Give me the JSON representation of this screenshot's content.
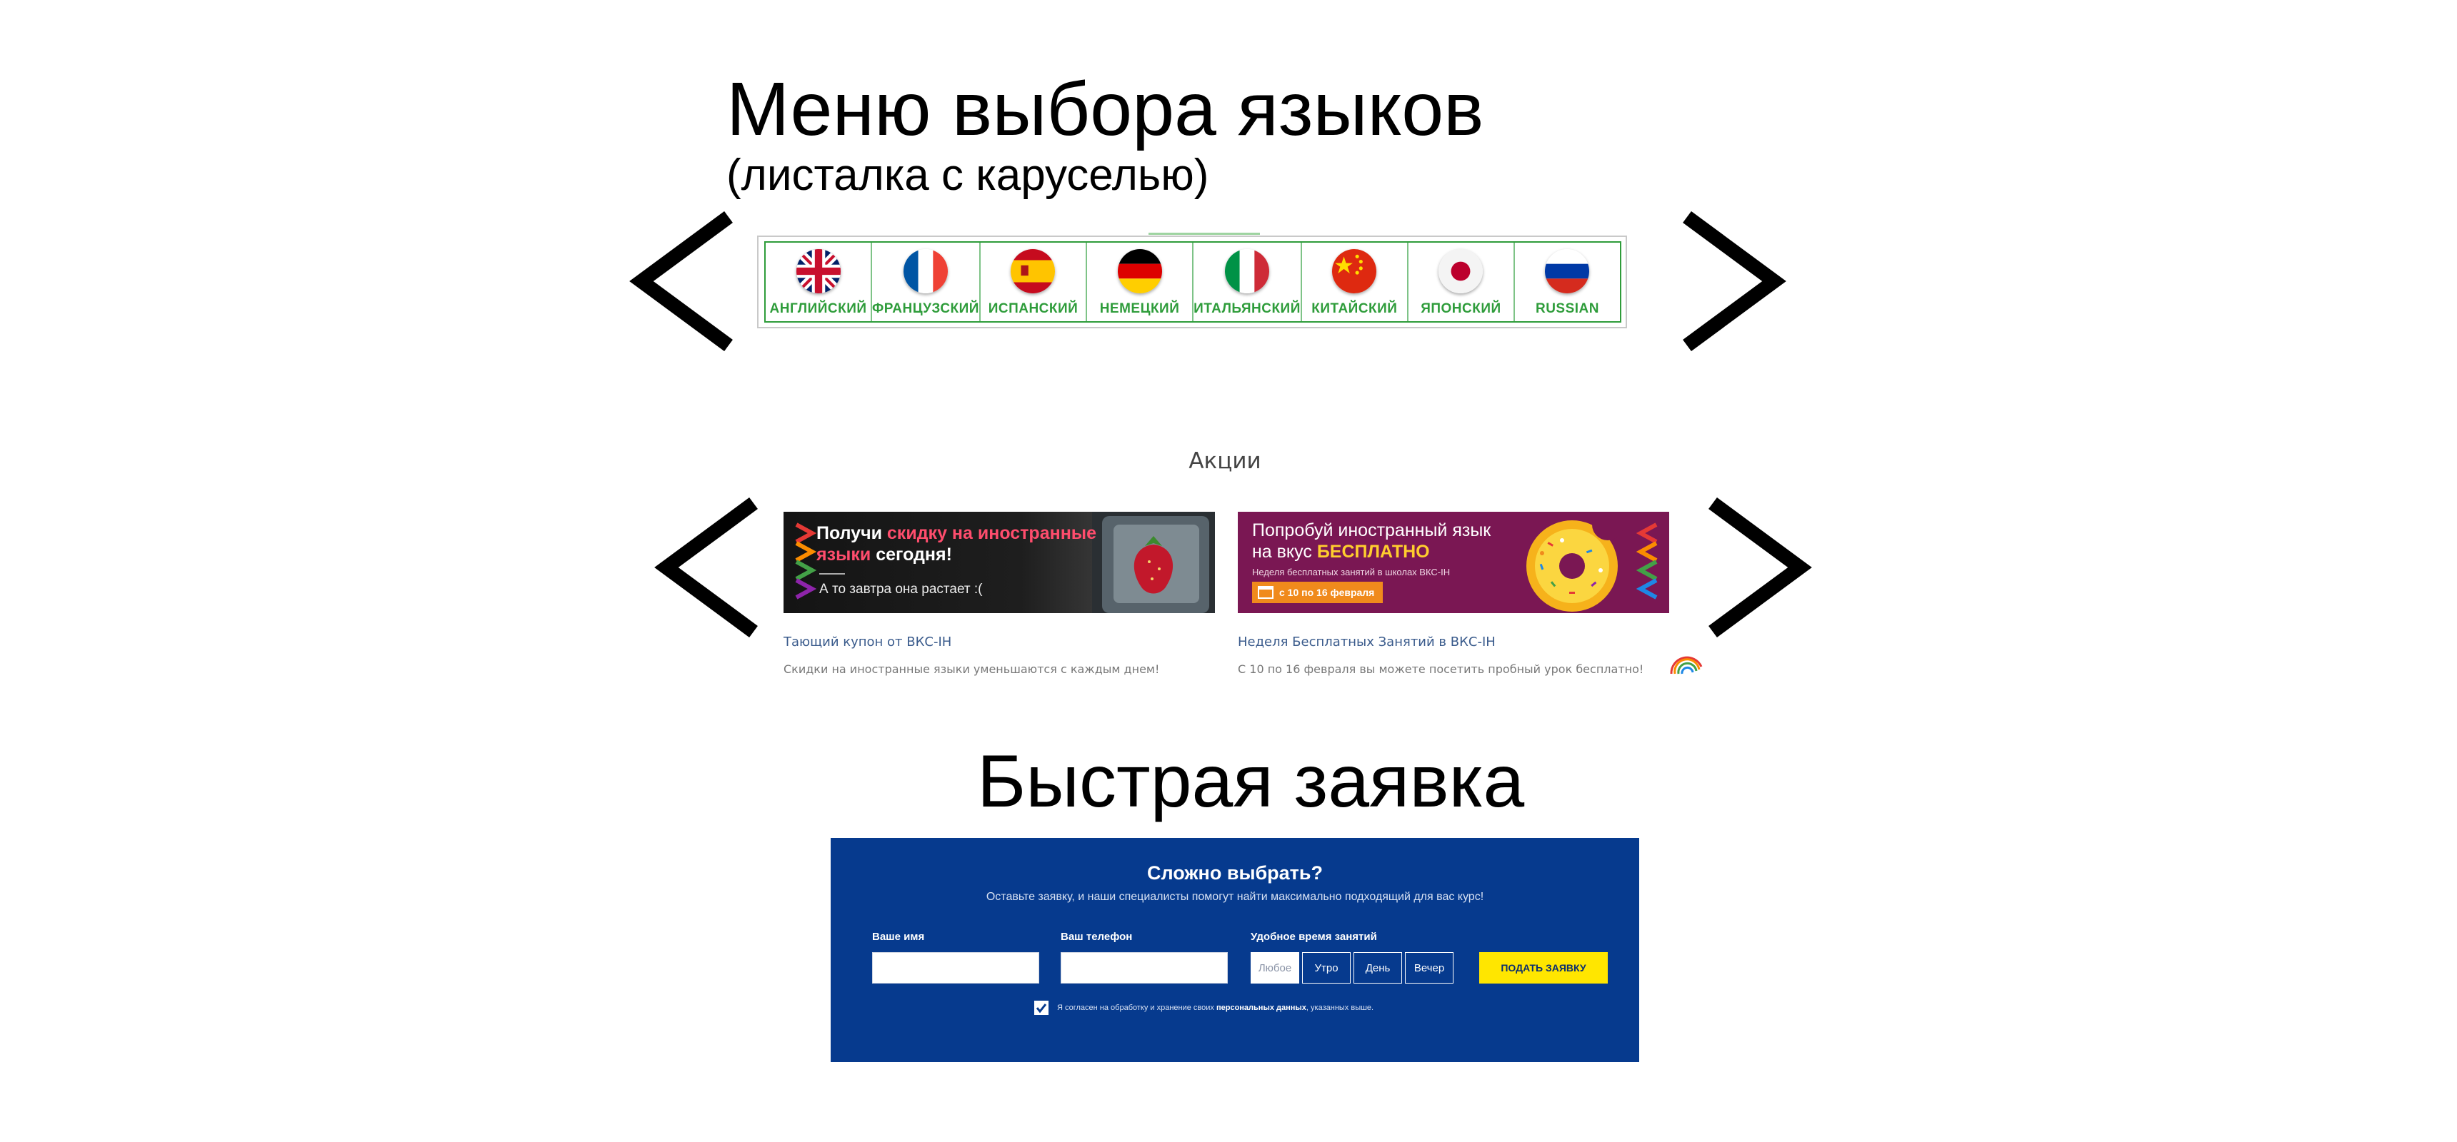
{
  "headings": {
    "language_menu_title": "Меню выбора языков",
    "language_menu_subtitle": "(листалка с каруселью)",
    "quick_request_title": "Быстрая заявка"
  },
  "languages": [
    {
      "label": "АНГЛИЙСКИЙ",
      "flag": "uk-flag-icon"
    },
    {
      "label": "ФРАНЦУЗСКИЙ",
      "flag": "france-flag-icon"
    },
    {
      "label": "ИСПАНСКИЙ",
      "flag": "spain-flag-icon"
    },
    {
      "label": "НЕМЕЦКИЙ",
      "flag": "germany-flag-icon"
    },
    {
      "label": "ИТАЛЬЯНСКИЙ",
      "flag": "italy-flag-icon"
    },
    {
      "label": "КИТАЙСКИЙ",
      "flag": "china-flag-icon"
    },
    {
      "label": "ЯПОНСКИЙ",
      "flag": "japan-flag-icon"
    },
    {
      "label": "RUSSIAN",
      "flag": "russia-flag-icon"
    }
  ],
  "promotions": {
    "heading": "Акции",
    "cards": [
      {
        "banner_line1_pre": "Получи ",
        "banner_line1_accent": "скидку на иностранные",
        "banner_line2_accent": "языки",
        "banner_line2_post": " сегодня!",
        "banner_line3": "А то завтра она растает :(",
        "link": "Тающий купон от ВКС-IH",
        "description": "Скидки на иностранные языки уменьшаются с каждым днем!"
      },
      {
        "banner_line1": "Попробуй иностранный язык",
        "banner_line2_pre": "на вкус ",
        "banner_line2_accent": "БЕСПЛАТНО",
        "banner_line3": "Неделя бесплатных занятий в школах ВКС-IH",
        "banner_badge": "с 10 по 16 февраля",
        "link": "Неделя Бесплатных Занятий в ВКС-IH",
        "description": "С 10 по 16 февраля вы можете посетить пробный урок бесплатно!"
      }
    ]
  },
  "form": {
    "title": "Сложно выбрать?",
    "subtitle": "Оставьте заявку, и наши специалисты помогут найти максимально подходящий для вас курс!",
    "name_label": "Ваше имя",
    "phone_label": "Ваш телефон",
    "time_label": "Удобное время занятий",
    "time_options": [
      "Любое",
      "Утро",
      "День",
      "Вечер"
    ],
    "selected_time": "Любое",
    "submit": "ПОДАТЬ ЗАЯВКУ",
    "consent_pre": "Я согласен на обработку и хранение своих ",
    "consent_bold": "персональных данных",
    "consent_post": ", указанных выше."
  },
  "colors": {
    "green": "#2e9c3a",
    "form_blue": "#063a8e",
    "submit_yellow": "#ffe600",
    "banner_purple": "#7a1753",
    "accent_pink": "#ff4d6d"
  }
}
